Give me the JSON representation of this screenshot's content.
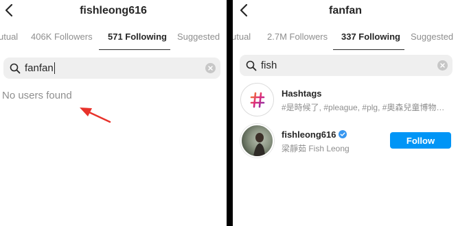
{
  "left": {
    "title": "fishleong616",
    "tabs": [
      "utual",
      "406K Followers",
      "571 Following",
      "Suggested"
    ],
    "active_tab": "571 Following",
    "search": {
      "value": "fanfan"
    },
    "empty_message": "No users found"
  },
  "right": {
    "title": "fanfan",
    "tabs": [
      "utual",
      "2.7M Followers",
      "337 Following",
      "Suggested"
    ],
    "active_tab": "337 Following",
    "search": {
      "value": "fish"
    },
    "results": [
      {
        "name": "Hashtags",
        "subtitle": "#是時候了, #pleague, #plg, #奧森兒童博物…",
        "icon": "hashtag-icon"
      },
      {
        "name": "fishleong616",
        "subtitle": "梁靜茹 Fish Leong",
        "verified": true,
        "button": "Follow"
      }
    ]
  },
  "annotation": {
    "icon": "red-arrow-icon",
    "color": "#e8322b"
  },
  "colors": {
    "accent": "#0095f6",
    "muted": "#8e8e8e",
    "text": "#262626",
    "divider": "#000000"
  }
}
